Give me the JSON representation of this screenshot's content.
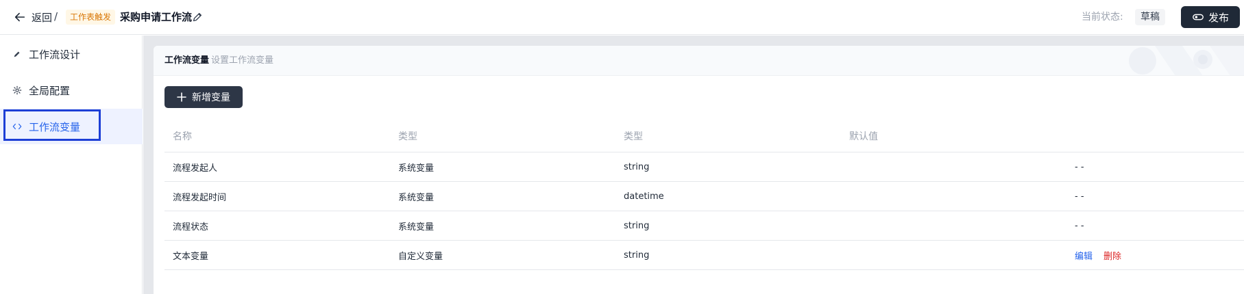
{
  "header": {
    "back_label": "返回",
    "separator": "/",
    "trigger_tag": "工作表触发",
    "title": "采购申请工作流",
    "status_label": "当前状态:",
    "status_value": "草稿",
    "publish_label": "发布"
  },
  "sidebar": {
    "items": [
      {
        "label": "工作流设计",
        "icon": "pencil-icon"
      },
      {
        "label": "全局配置",
        "icon": "gear-icon"
      },
      {
        "label": "工作流变量",
        "icon": "code-icon",
        "active": true
      }
    ]
  },
  "main": {
    "card_title": "工作流变量",
    "card_subtitle": "设置工作流变量",
    "add_button_label": "新增变量",
    "table": {
      "headers": [
        "名称",
        "类型",
        "类型",
        "默认值",
        ""
      ],
      "rows": [
        {
          "name": "流程发起人",
          "category": "系统变量",
          "type": "string",
          "default": "",
          "action": "- -"
        },
        {
          "name": "流程发起时间",
          "category": "系统变量",
          "type": "datetime",
          "default": "",
          "action": "- -"
        },
        {
          "name": "流程状态",
          "category": "系统变量",
          "type": "string",
          "default": "",
          "action": "- -"
        },
        {
          "name": "文本变量",
          "category": "自定义变量",
          "type": "string",
          "default": "",
          "edit_label": "编辑",
          "delete_label": "删除"
        }
      ]
    }
  },
  "colors": {
    "accent": "#2563eb",
    "danger": "#dc2626",
    "dark_button": "#1f2937",
    "tag_orange": "#d97706"
  }
}
